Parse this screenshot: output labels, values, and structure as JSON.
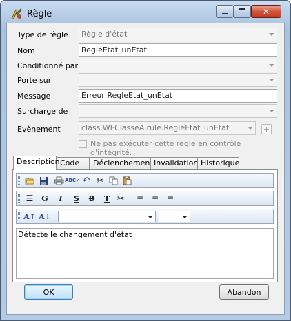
{
  "window": {
    "title": "Règle"
  },
  "fields": [
    {
      "label": "Type de règle",
      "value": "Règle d'état",
      "kind": "dropdown",
      "enabled": false
    },
    {
      "label": "Nom",
      "value": "RegleEtat_unEtat",
      "kind": "text",
      "enabled": true
    },
    {
      "label": "Conditionné par",
      "value": "",
      "kind": "dropdown",
      "enabled": false
    },
    {
      "label": "Porte sur",
      "value": "",
      "kind": "dropdown",
      "enabled": false
    },
    {
      "label": "Message",
      "value": "Erreur RegleEtat_unEtat",
      "kind": "text",
      "enabled": true
    },
    {
      "label": "Surcharge de",
      "value": "",
      "kind": "dropdown",
      "enabled": false
    },
    {
      "label": "Evènement",
      "value": "class.WFClasseA.rule.RegleEtat_unEtat",
      "kind": "dropdown",
      "enabled": false
    }
  ],
  "plus_label": "+",
  "checkbox": {
    "label": "Ne pas exécuter cette règle en contrôle d'intégrité.",
    "checked": false
  },
  "tabs": [
    "Description",
    "Code",
    "Déclenchement",
    "Invalidation",
    "Historique"
  ],
  "active_tab": "Description",
  "toolbar": {
    "bold": "G",
    "italic": "I",
    "underline": "S",
    "strike": "B"
  },
  "description_text": "Détecte le changement d'état",
  "buttons": {
    "ok": "OK",
    "cancel": "Abandon"
  },
  "colors": {
    "title_bar": "#b4cbe4",
    "close_button": "#c33a1f",
    "ok_border": "#3c7fb1"
  }
}
